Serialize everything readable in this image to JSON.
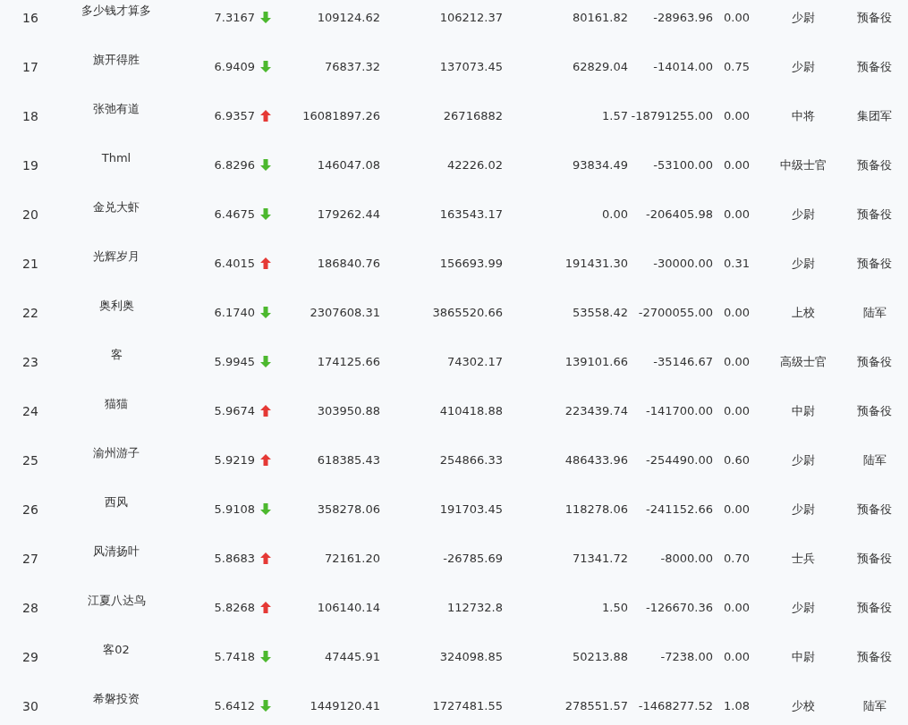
{
  "table": {
    "rows": [
      {
        "rank": "16",
        "name": "多少钱才算多",
        "score": "7.3167",
        "kind": "down",
        "column_4": "109124.62",
        "column_5": "106212.37",
        "column_6": "80161.82",
        "column_7": "-28963.96",
        "column_8": "0.00",
        "column_9": "少尉",
        "column_10": "预备役"
      },
      {
        "rank": "17",
        "name": "旗开得胜",
        "score": "6.9409",
        "kind": "down",
        "column_4": "76837.32",
        "column_5": "137073.45",
        "column_6": "62829.04",
        "column_7": "-14014.00",
        "column_8": "0.75",
        "column_9": "少尉",
        "column_10": "预备役"
      },
      {
        "rank": "18",
        "name": "张弛有道",
        "score": "6.9357",
        "kind": "up",
        "column_4": "16081897.26",
        "column_5": "26716882",
        "column_6": "1.57",
        "column_7": "-18791255.00",
        "column_8": "0.00",
        "column_9": "中将",
        "column_10": "集团军"
      },
      {
        "rank": "19",
        "name": "Thml",
        "score": "6.8296",
        "kind": "down",
        "column_4": "146047.08",
        "column_5": "42226.02",
        "column_6": "93834.49",
        "column_7": "-53100.00",
        "column_8": "0.00",
        "column_9": "中级士官",
        "column_10": "预备役"
      },
      {
        "rank": "20",
        "name": "金兑大虾",
        "score": "6.4675",
        "kind": "down",
        "column_4": "179262.44",
        "column_5": "163543.17",
        "column_6": "0.00",
        "column_7": "-206405.98",
        "column_8": "0.00",
        "column_9": "少尉",
        "column_10": "预备役"
      },
      {
        "rank": "21",
        "name": "光辉岁月",
        "score": "6.4015",
        "kind": "up",
        "column_4": "186840.76",
        "column_5": "156693.99",
        "column_6": "191431.30",
        "column_7": "-30000.00",
        "column_8": "0.31",
        "column_9": "少尉",
        "column_10": "预备役"
      },
      {
        "rank": "22",
        "name": "奥利奥",
        "score": "6.1740",
        "kind": "down",
        "column_4": "2307608.31",
        "column_5": "3865520.66",
        "column_6": "53558.42",
        "column_7": "-2700055.00",
        "column_8": "0.00",
        "column_9": "上校",
        "column_10": "陆军"
      },
      {
        "rank": "23",
        "name": "客",
        "score": "5.9945",
        "kind": "down",
        "column_4": "174125.66",
        "column_5": "74302.17",
        "column_6": "139101.66",
        "column_7": "-35146.67",
        "column_8": "0.00",
        "column_9": "高级士官",
        "column_10": "预备役"
      },
      {
        "rank": "24",
        "name": "猫猫",
        "score": "5.9674",
        "kind": "up",
        "column_4": "303950.88",
        "column_5": "410418.88",
        "column_6": "223439.74",
        "column_7": "-141700.00",
        "column_8": "0.00",
        "column_9": "中尉",
        "column_10": "预备役"
      },
      {
        "rank": "25",
        "name": "渝州游子",
        "score": "5.9219",
        "kind": "up",
        "column_4": "618385.43",
        "column_5": "254866.33",
        "column_6": "486433.96",
        "column_7": "-254490.00",
        "column_8": "0.60",
        "column_9": "少尉",
        "column_10": "陆军"
      },
      {
        "rank": "26",
        "name": "西风",
        "score": "5.9108",
        "kind": "down",
        "column_4": "358278.06",
        "column_5": "191703.45",
        "column_6": "118278.06",
        "column_7": "-241152.66",
        "column_8": "0.00",
        "column_9": "少尉",
        "column_10": "预备役"
      },
      {
        "rank": "27",
        "name": "风清扬叶",
        "score": "5.8683",
        "kind": "up",
        "column_4": "72161.20",
        "column_5": "-26785.69",
        "column_6": "71341.72",
        "column_7": "-8000.00",
        "column_8": "0.70",
        "column_9": "士兵",
        "column_10": "预备役"
      },
      {
        "rank": "28",
        "name": "江夏八达鸟",
        "score": "5.8268",
        "kind": "up",
        "column_4": "106140.14",
        "column_5": "112732.8",
        "column_6": "1.50",
        "column_7": "-126670.36",
        "column_8": "0.00",
        "column_9": "少尉",
        "column_10": "预备役"
      },
      {
        "rank": "29",
        "name": "客02",
        "score": "5.7418",
        "kind": "down",
        "column_4": "47445.91",
        "column_5": "324098.85",
        "column_6": "50213.88",
        "column_7": "-7238.00",
        "column_8": "0.00",
        "column_9": "中尉",
        "column_10": "预备役"
      },
      {
        "rank": "30",
        "name": "希磐投资",
        "score": "5.6412",
        "kind": "down",
        "column_4": "1449120.41",
        "column_5": "1727481.55",
        "column_6": "278551.57",
        "column_7": "-1468277.52",
        "column_8": "1.08",
        "column_9": "少校",
        "column_10": "陆军"
      }
    ]
  }
}
